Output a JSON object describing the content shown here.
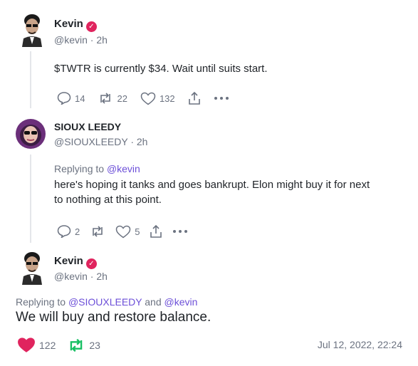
{
  "tweets": [
    {
      "name": "Kevin",
      "handle": "@kevin",
      "time": "2h",
      "text": "$TWTR is currently $34. Wait until suits start.",
      "reply_count": "14",
      "retweet_count": "22",
      "like_count": "132"
    },
    {
      "name": "SIOUX LEEDY",
      "handle": "@SIOUXLEEDY",
      "time": "2h",
      "replying_label": "Replying to",
      "replying_handle": "@kevin",
      "text_line1": "here's hoping it tanks and goes bankrupt. Elon might buy it for next",
      "text_line2": "to nothing at this point.",
      "reply_count": "2",
      "like_count": "5"
    },
    {
      "name": "Kevin",
      "handle": "@kevin",
      "time": "2h",
      "replying_label": "Replying to",
      "replying_handle1": "@SIOUXLEEDY",
      "replying_and": "and",
      "replying_handle2": "@kevin",
      "text": "We will buy and restore balance.",
      "like_count": "122",
      "retweet_count": "23",
      "timestamp": "Jul 12, 2022, 22:24"
    }
  ],
  "colors": {
    "verified": "#e0245e",
    "link": "#6c4fd8",
    "like_active": "#e0245e",
    "retweet_active": "#17bf63",
    "muted": "#6b7280"
  },
  "icons": [
    "verified-icon",
    "reply-icon",
    "retweet-icon",
    "like-icon",
    "share-icon",
    "more-icon"
  ],
  "separator": "·"
}
